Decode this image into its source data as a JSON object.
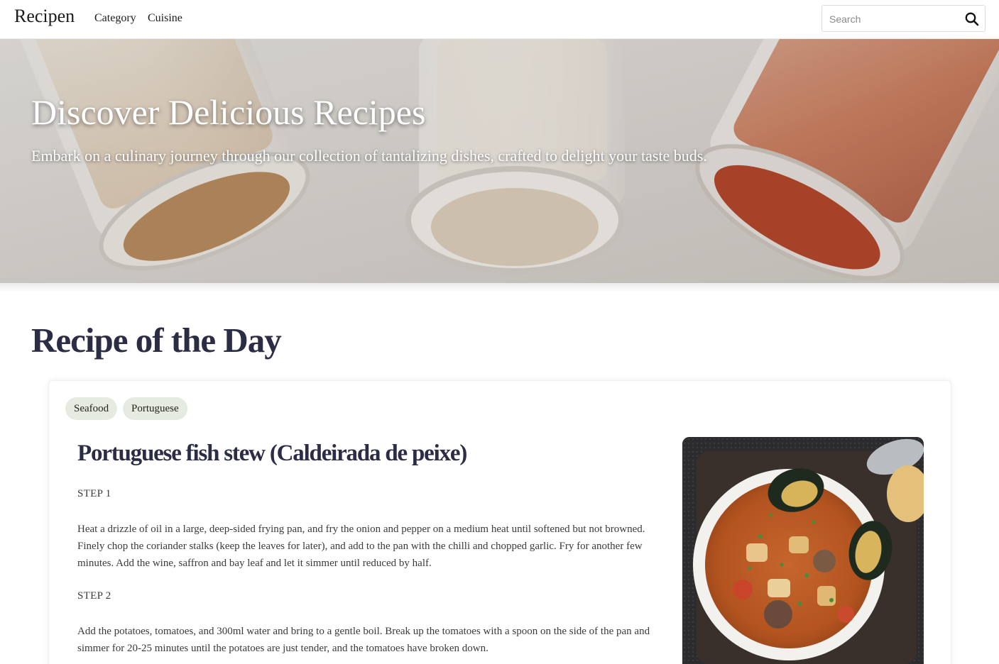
{
  "navbar": {
    "brand": "Recipen",
    "links": [
      "Category",
      "Cuisine"
    ],
    "search_placeholder": "Search",
    "search_value": ""
  },
  "hero": {
    "title": "Discover Delicious Recipes",
    "subtitle": "Embark on a culinary journey through our collection of tantalizing dishes, crafted to delight your taste buds."
  },
  "section": {
    "title": "Recipe of the Day"
  },
  "recipe": {
    "tags": [
      "Seafood",
      "Portuguese"
    ],
    "title": "Portuguese fish stew (Caldeirada de peixe)",
    "steps": [
      {
        "label": "STEP 1",
        "text": "Heat a drizzle of oil in a large, deep-sided frying pan, and fry the onion and pepper on a medium heat until softened but not browned. Finely chop the coriander stalks (keep the leaves for later), and add to the pan with the chilli and chopped garlic. Fry for another few minutes. Add the wine, saffron and bay leaf and let it simmer until reduced by half."
      },
      {
        "label": "STEP 2",
        "text": "Add the potatoes, tomatoes, and 300ml water and bring to a gentle boil. Break up the tomatoes with a spoon on the side of the pan and simmer for 20-25 minutes until the potatoes are just tender, and the tomatoes have broken down."
      }
    ]
  },
  "icons": {
    "search": "search-icon"
  }
}
